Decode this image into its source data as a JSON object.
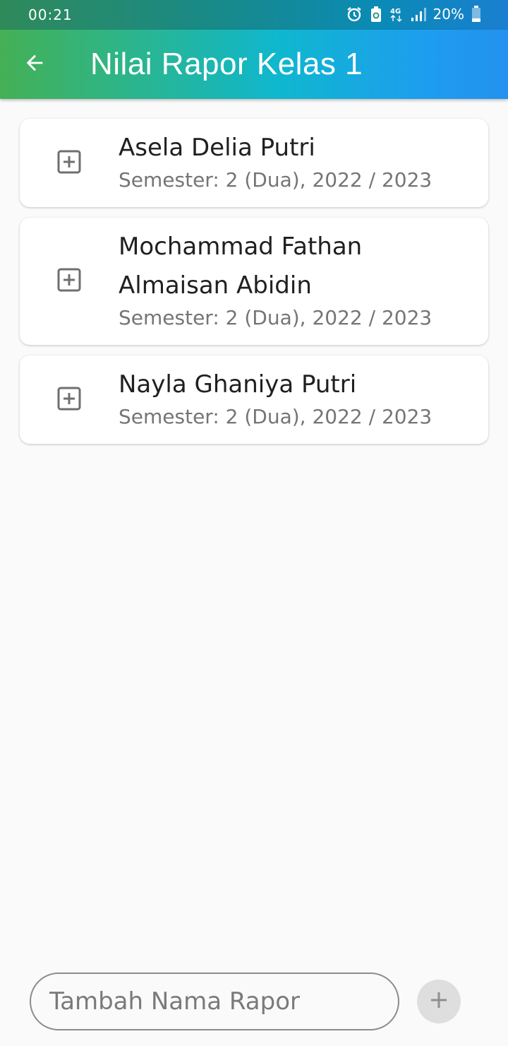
{
  "status_bar": {
    "time": "00:21",
    "network": "4G",
    "battery": "20%",
    "icons": [
      "alarm-icon",
      "battery-saver-icon",
      "network-4g-icon",
      "signal-icon",
      "battery-icon"
    ]
  },
  "app_bar": {
    "back_icon": "arrow-left-icon",
    "title": "Nilai Rapor Kelas 1",
    "colors": {
      "gradient_start": "#45b055",
      "gradient_mid": "#0fb7cf",
      "gradient_end": "#2392ee"
    }
  },
  "reports": [
    {
      "icon": "add-box-icon",
      "name": "Asela Delia Putri",
      "subtitle": "Semester: 2 (Dua),  2022 / 2023"
    },
    {
      "icon": "add-box-icon",
      "name": "Mochammad Fathan Almaisan Abidin",
      "subtitle": "Semester: 2 (Dua),  2022 / 2023"
    },
    {
      "icon": "add-box-icon",
      "name": "Nayla Ghaniya Putri",
      "subtitle": "Semester: 2 (Dua),  2022 / 2023"
    }
  ],
  "bottom": {
    "input_placeholder": "Tambah Nama Rapor",
    "input_value": "",
    "add_icon": "plus-icon"
  }
}
